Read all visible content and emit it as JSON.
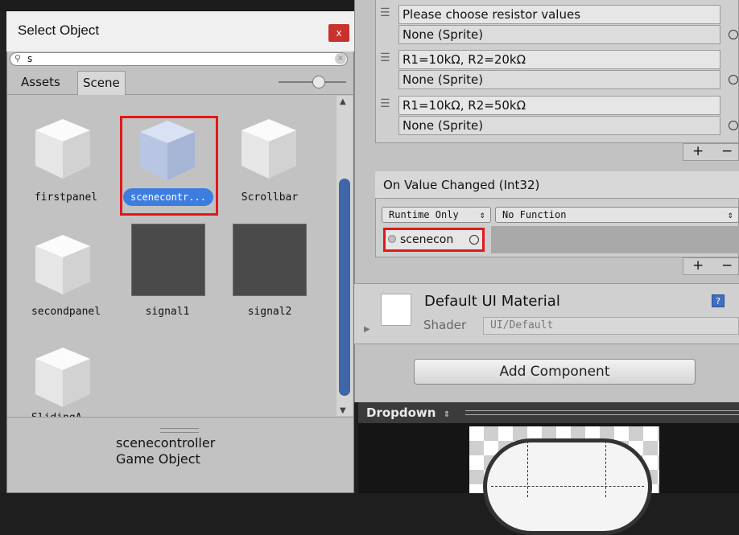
{
  "select_object": {
    "title": "Select Object",
    "close_glyph": "x",
    "search_value": "s",
    "tabs": [
      "Assets",
      "Scene"
    ],
    "items": [
      {
        "label": "firstpanel",
        "kind": "cube"
      },
      {
        "label": "scenecontr...",
        "kind": "cube",
        "selected": true
      },
      {
        "label": "Scrollbar",
        "kind": "cube"
      },
      {
        "label": "secondpanel",
        "kind": "cube"
      },
      {
        "label": "signal1",
        "kind": "sprite"
      },
      {
        "label": "signal2",
        "kind": "sprite"
      },
      {
        "label": "SlidingA...",
        "kind": "cube"
      }
    ],
    "detail": {
      "name": "scenecontroller",
      "type": "Game Object"
    }
  },
  "inspector": {
    "options": [
      {
        "text": "Please choose resistor values",
        "image": "None (Sprite)"
      },
      {
        "text": "R1=10kΩ, R2=20kΩ",
        "image": "None (Sprite)"
      },
      {
        "text": "R1=10kΩ, R2=50kΩ",
        "image": "None (Sprite)"
      }
    ],
    "plus": "+",
    "minus": "−",
    "event_title": "On Value Changed (Int32)",
    "runtime_mode": "Runtime Only",
    "function": "No Function",
    "object_ref": "scenecon",
    "material_name": "Default UI Material",
    "shader_label": "Shader",
    "shader_value": "UI/Default",
    "add_component": "Add Component"
  },
  "preview": {
    "title": "Dropdown"
  },
  "colors": {
    "selection": "#3d7de0",
    "highlight_box": "#e0191b",
    "scroll_thumb": "#3e66a9"
  }
}
